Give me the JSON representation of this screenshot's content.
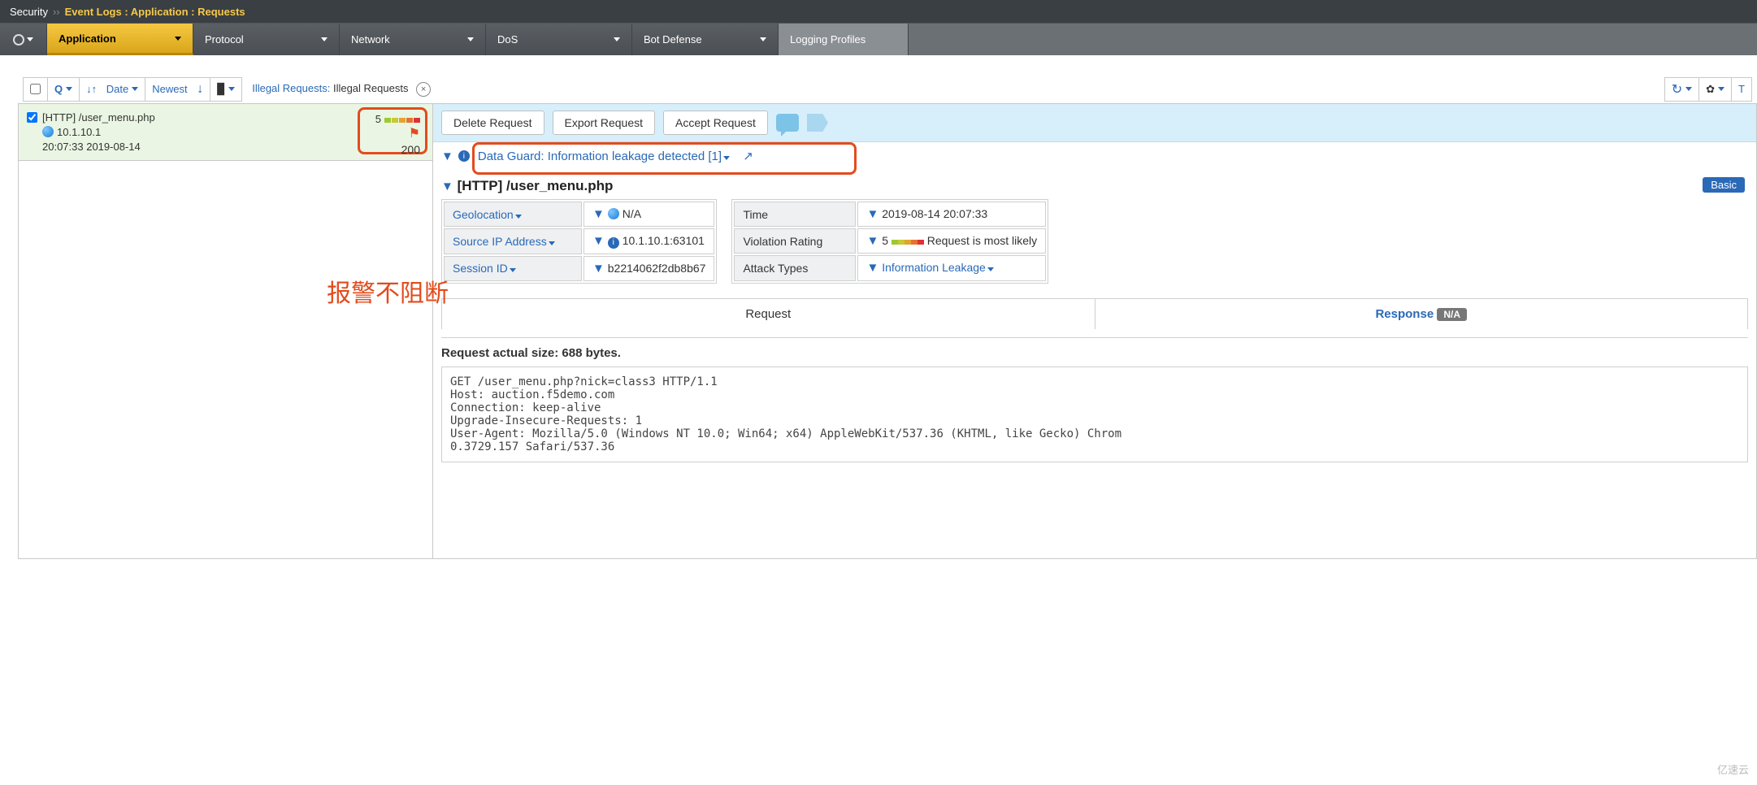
{
  "breadcrumb": {
    "root": "Security",
    "separator": "››",
    "path": "Event Logs : Application : Requests"
  },
  "tabs": [
    "Application",
    "Protocol",
    "Network",
    "DoS",
    "Bot Defense",
    "Logging Profiles"
  ],
  "toolbar": {
    "sort_field": "Date",
    "order": "Newest",
    "filter_label": "Illegal Requests:",
    "filter_value": "Illegal Requests"
  },
  "log_entry": {
    "protocol": "[HTTP]",
    "path": "/user_menu.php",
    "ip": "10.1.10.1",
    "timestamp": "20:07:33 2019-08-14",
    "rating": "5",
    "status": "200"
  },
  "annotation": "报警不阻断",
  "actions": {
    "delete": "Delete Request",
    "export": "Export Request",
    "accept": "Accept Request"
  },
  "violation_summary": "Data Guard: Information leakage detected [1]",
  "detail_title": {
    "protocol": "[HTTP]",
    "path": "/user_menu.php",
    "mode": "Basic"
  },
  "left_table": {
    "geolocation_label": "Geolocation",
    "geolocation_value": "N/A",
    "sourceip_label": "Source IP Address",
    "sourceip_value": "10.1.10.1:63101",
    "session_label": "Session ID",
    "session_value": "b2214062f2db8b67"
  },
  "right_table": {
    "time_label": "Time",
    "time_value": "2019-08-14 20:07:33",
    "rating_label": "Violation Rating",
    "rating_value": "5",
    "rating_txt": "Request is most likely",
    "attack_label": "Attack Types",
    "attack_value": "Information Leakage"
  },
  "body_tabs": {
    "request": "Request",
    "response": "Response",
    "response_badge": "N/A"
  },
  "request_detail": {
    "size_label": "Request actual size: 688 bytes.",
    "raw": "GET /user_menu.php?nick=class3 HTTP/1.1\nHost: auction.f5demo.com\nConnection: keep-alive\nUpgrade-Insecure-Requests: 1\nUser-Agent: Mozilla/5.0 (Windows NT 10.0; Win64; x64) AppleWebKit/537.36 (KHTML, like Gecko) Chrom\n0.3729.157 Safari/537.36"
  },
  "watermark": "亿速云"
}
